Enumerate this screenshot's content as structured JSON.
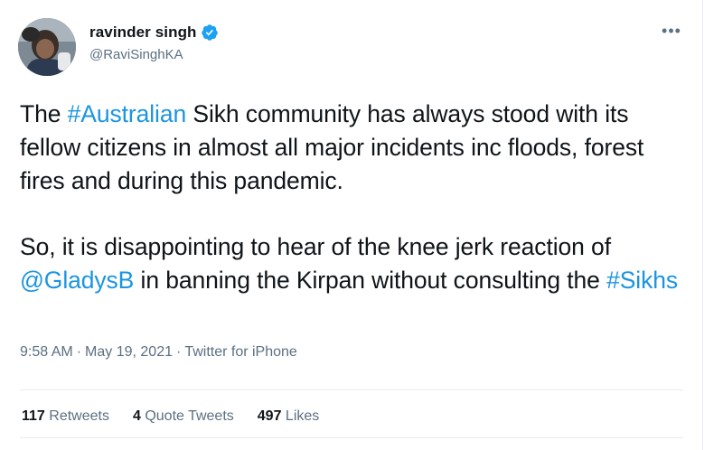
{
  "tweet": {
    "author": {
      "display_name": "ravinder singh",
      "handle": "@RaviSinghKA",
      "verified": true
    },
    "more_icon": "more-dots-icon",
    "text": {
      "p1": {
        "pre": "The ",
        "hashtag": "#Australian",
        "post": " Sikh community has always stood with its fellow citizens in almost all major incidents inc floods, forest fires and during this pandemic."
      },
      "p2": {
        "pre": "So, it is disappointing to hear of the knee jerk reaction of ",
        "mention": "@GladysB",
        "mid": " in banning the Kirpan without consulting the ",
        "hashtag": "#Sikhs"
      }
    },
    "meta": {
      "time": "9:58 AM",
      "separator": "·",
      "date": "May 19, 2021",
      "source": "Twitter for iPhone"
    },
    "stats": {
      "retweets": {
        "count": "117",
        "label": "Retweets"
      },
      "quote_tweets": {
        "count": "4",
        "label": "Quote Tweets"
      },
      "likes": {
        "count": "497",
        "label": "Likes"
      }
    },
    "colors": {
      "link": "#1b95e0",
      "secondary_text": "#5b7083",
      "verified": "#1da1f2"
    }
  }
}
